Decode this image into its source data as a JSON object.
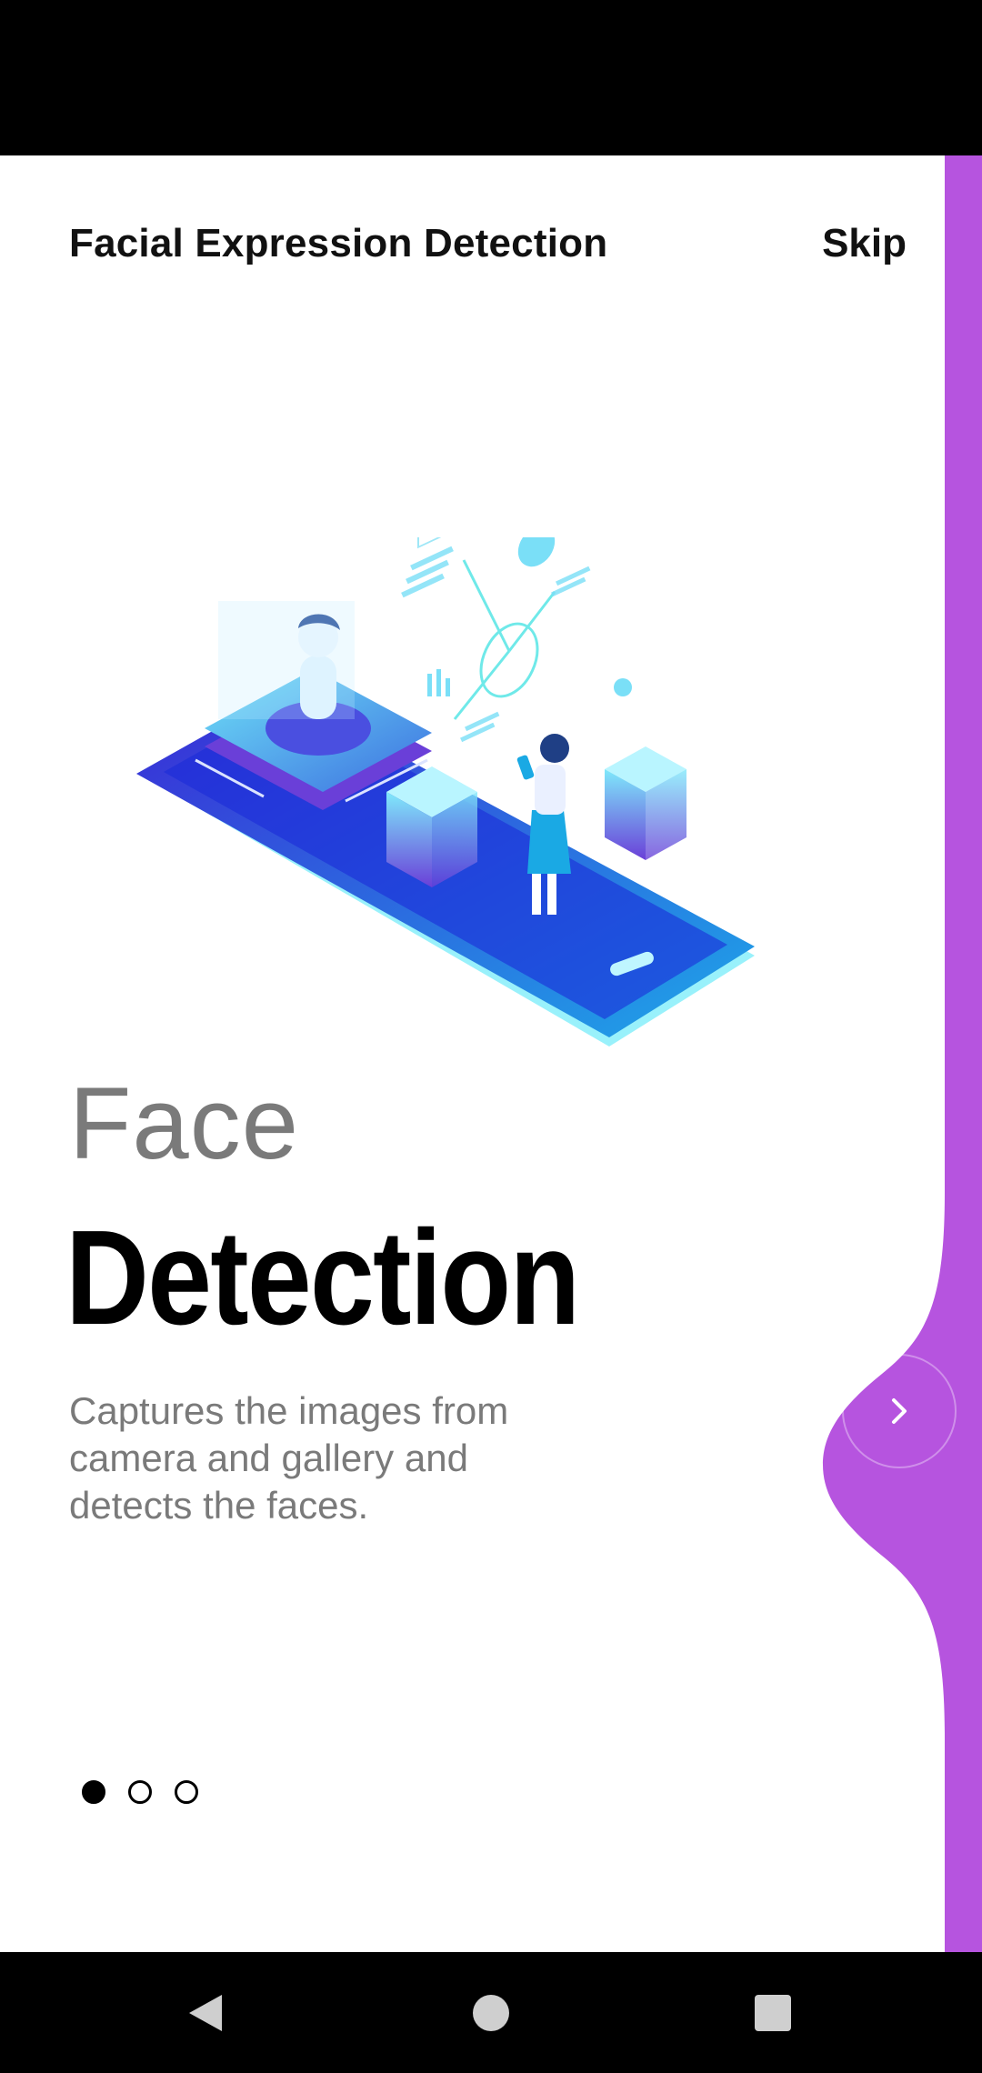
{
  "app": {
    "title": "Facial Expression Detection",
    "skip_label": "Skip"
  },
  "onboarding": {
    "heading_light": "Face",
    "heading_bold": "Detection",
    "description": "Captures the images from camera and gallery and detects the faces.",
    "current_page": 1,
    "total_pages": 3,
    "next_icon": "chevron-right-icon"
  },
  "navigation": {
    "back_icon": "back-triangle-icon",
    "home_icon": "home-circle-icon",
    "recents_icon": "recents-square-icon"
  },
  "colors": {
    "accent": "#B654DF",
    "text_dark": "#111111",
    "text_muted": "#7A7A7A"
  }
}
